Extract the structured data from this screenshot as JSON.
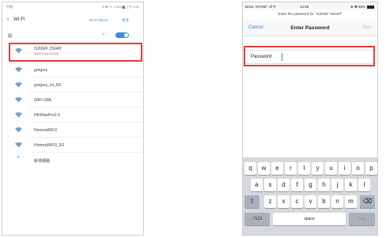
{
  "left": {
    "status_left": "中国",
    "status_right": "N ✱ ⓦ .ıl 12%▆ 上午 9:41",
    "back_icon": "back-chevron-icon",
    "title": "WI-FI",
    "direct_label": "Wi-Fi Direct",
    "more_label": "更多",
    "toggle_label": "開",
    "toggle_on": true,
    "networks": [
      {
        "name": "iS20WF 25040f",
        "sub": "網路無法連線(未經驗證)"
      },
      {
        "name": "gregory",
        "sub": ""
      },
      {
        "name": "gregory_mi_5G",
        "sub": ""
      },
      {
        "name": "WIFI-GML",
        "sub": ""
      },
      {
        "name": "HKWisePro2.4",
        "sub": ""
      },
      {
        "name": "HonmaWiFi3",
        "sub": ""
      },
      {
        "name": "HonmaWiFi3_5G",
        "sub": ""
      }
    ],
    "add_network": "新增網路",
    "colors": {
      "accent": "#3b8bd6",
      "highlight": "#e23b3b"
    }
  },
  "right": {
    "status_left": "Brew: STONF .ıll ᯤ",
    "status_time": "14:58",
    "status_right": "⊕ ✱ 58%",
    "prompt": "Enter the password for \"iS20WF 25040f\"",
    "cancel": "Cancel",
    "title": "Enter Password",
    "join": "Join",
    "password_label": "Password",
    "keyboard": {
      "row1": [
        "q",
        "w",
        "e",
        "r",
        "t",
        "y",
        "u",
        "i",
        "o",
        "p"
      ],
      "row2": [
        "a",
        "s",
        "d",
        "f",
        "g",
        "h",
        "j",
        "k",
        "l"
      ],
      "row3": [
        "z",
        "x",
        "c",
        "v",
        "b",
        "n",
        "m"
      ],
      "shift_icon": "shift-icon",
      "delete_icon": "delete-icon",
      "numbers": ".?123",
      "space": "space",
      "join": "Join"
    }
  }
}
